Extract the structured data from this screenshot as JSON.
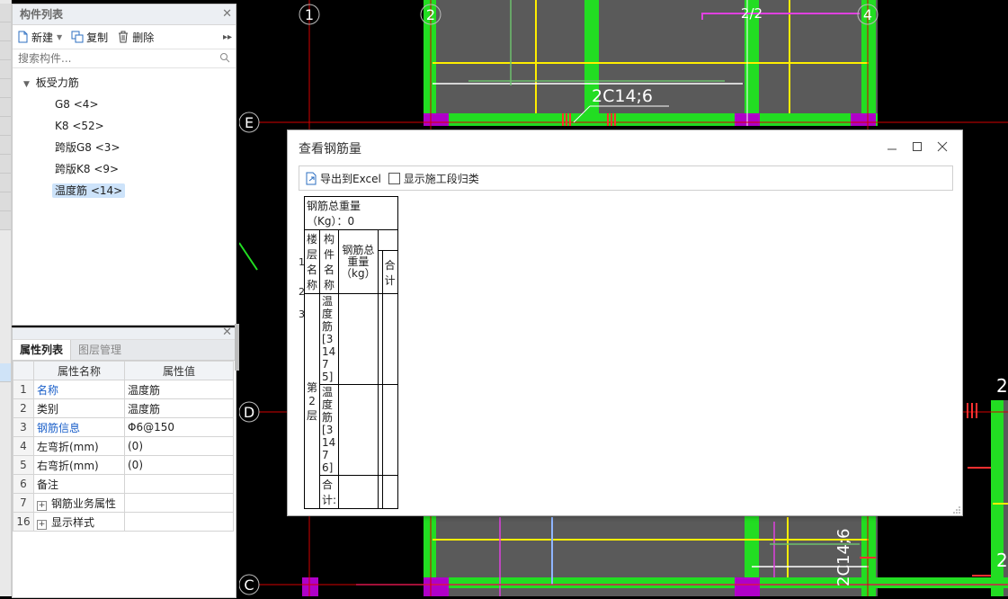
{
  "component_list": {
    "title": "构件列表",
    "toolbar": {
      "new_label": "新建",
      "copy_label": "复制",
      "delete_label": "删除"
    },
    "search_placeholder": "搜索构件...",
    "tree_root": "板受力筋",
    "items": [
      {
        "label": "G8 <4>"
      },
      {
        "label": "K8 <52>"
      },
      {
        "label": "跨版G8 <3>"
      },
      {
        "label": "跨版K8 <9>"
      },
      {
        "label": "温度筋 <14>",
        "selected": true
      }
    ]
  },
  "property_panel": {
    "tabs": [
      {
        "label": "属性列表",
        "active": true
      },
      {
        "label": "图层管理",
        "active": false
      }
    ],
    "header": {
      "name": "属性名称",
      "value": "属性值"
    },
    "rows": [
      {
        "num": "1",
        "name": "名称",
        "value": "温度筋",
        "blue": true
      },
      {
        "num": "2",
        "name": "类别",
        "value": "温度筋",
        "blue": false
      },
      {
        "num": "3",
        "name": "钢筋信息",
        "value": "Φ6@150",
        "blue": true
      },
      {
        "num": "4",
        "name": "左弯折(mm)",
        "value": "(0)",
        "blue": false
      },
      {
        "num": "5",
        "name": "右弯折(mm)",
        "value": "(0)",
        "blue": false
      },
      {
        "num": "6",
        "name": "备注",
        "value": "",
        "blue": false
      },
      {
        "num": "7",
        "name": "钢筋业务属性",
        "value": "",
        "expand": true
      },
      {
        "num": "16",
        "name": "显示样式",
        "value": "",
        "expand": true
      }
    ]
  },
  "cad": {
    "axis_labels": {
      "a1": "1",
      "a2": "2",
      "a4": "4",
      "aE": "E",
      "aD": "D",
      "aC": "C",
      "a22": "2/2",
      "aright1": "2",
      "aright2": "2"
    },
    "annotation_top": "2C14;6",
    "annotation_bottom": "2C14;6"
  },
  "dialog": {
    "title": "查看钢筋量",
    "export_label": "导出到Excel",
    "checkbox_label": "显示施工段归类",
    "total_weight": "钢筋总重量（Kg）：0",
    "col_floor": "楼层名称",
    "col_component": "构件名称",
    "col_weight": "钢筋总重量（kg）",
    "col_sum": "合计",
    "row_nums": [
      "1",
      "2",
      "3"
    ],
    "floor": "第2层",
    "rows": [
      {
        "component": "温度筋[31475]"
      },
      {
        "component": "温度筋[31476]"
      },
      {
        "component": "合计:"
      }
    ]
  }
}
